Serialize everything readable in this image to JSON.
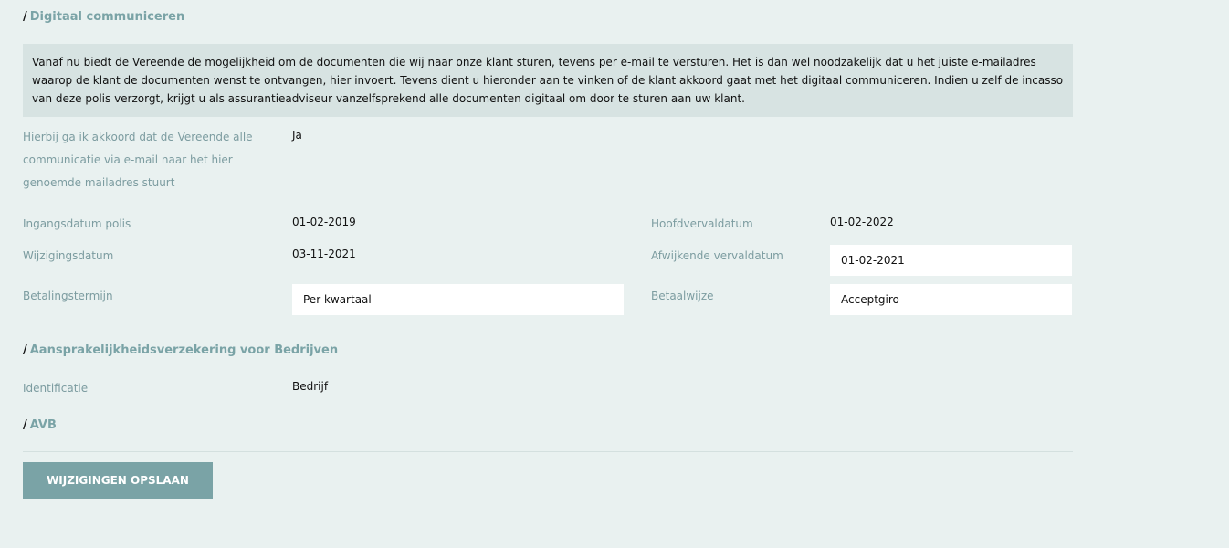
{
  "sections": {
    "digital": {
      "title": "Digitaal communiceren",
      "info_text": "Vanaf nu biedt de Vereende de mogelijkheid om de documenten die wij naar onze klant sturen, tevens per e-mail te versturen. Het is dan wel noodzakelijk dat u het juiste e-mailadres waarop de klant de documenten wenst te ontvangen, hier invoert. Tevens dient u hieronder aan te vinken of de klant akkoord gaat met het digitaal communiceren. Indien u zelf de incasso van deze polis verzorgt, krijgt u als assurantieadviseur vanzelfsprekend alle documenten digitaal om door te sturen aan uw klant."
    },
    "liability": {
      "title": "Aansprakelijkheidsverzekering voor Bedrijven"
    },
    "avb": {
      "title": "AVB"
    }
  },
  "fields": {
    "consent_label": "Hierbij ga ik akkoord dat de Vereende alle communicatie via e-mail naar het hier genoemde mailadres stuurt",
    "consent_value": "Ja",
    "start_date_label": "Ingangsdatum polis",
    "start_date_value": "01-02-2019",
    "main_due_label": "Hoofdvervaldatum",
    "main_due_value": "01-02-2022",
    "change_date_label": "Wijzigingsdatum",
    "change_date_value": "03-11-2021",
    "alt_due_label": "Afwijkende vervaldatum",
    "alt_due_value": "01-02-2021",
    "payment_term_label": "Betalingstermijn",
    "payment_term_value": "Per kwartaal",
    "payment_method_label": "Betaalwijze",
    "payment_method_value": "Acceptgiro",
    "identification_label": "Identificatie",
    "identification_value": "Bedrijf"
  },
  "actions": {
    "save_label": "WIJZIGINGEN OPSLAAN"
  },
  "colors": {
    "background": "#e9f1f0",
    "accent": "#7aa3a6",
    "info_box": "#d7e3e2"
  }
}
